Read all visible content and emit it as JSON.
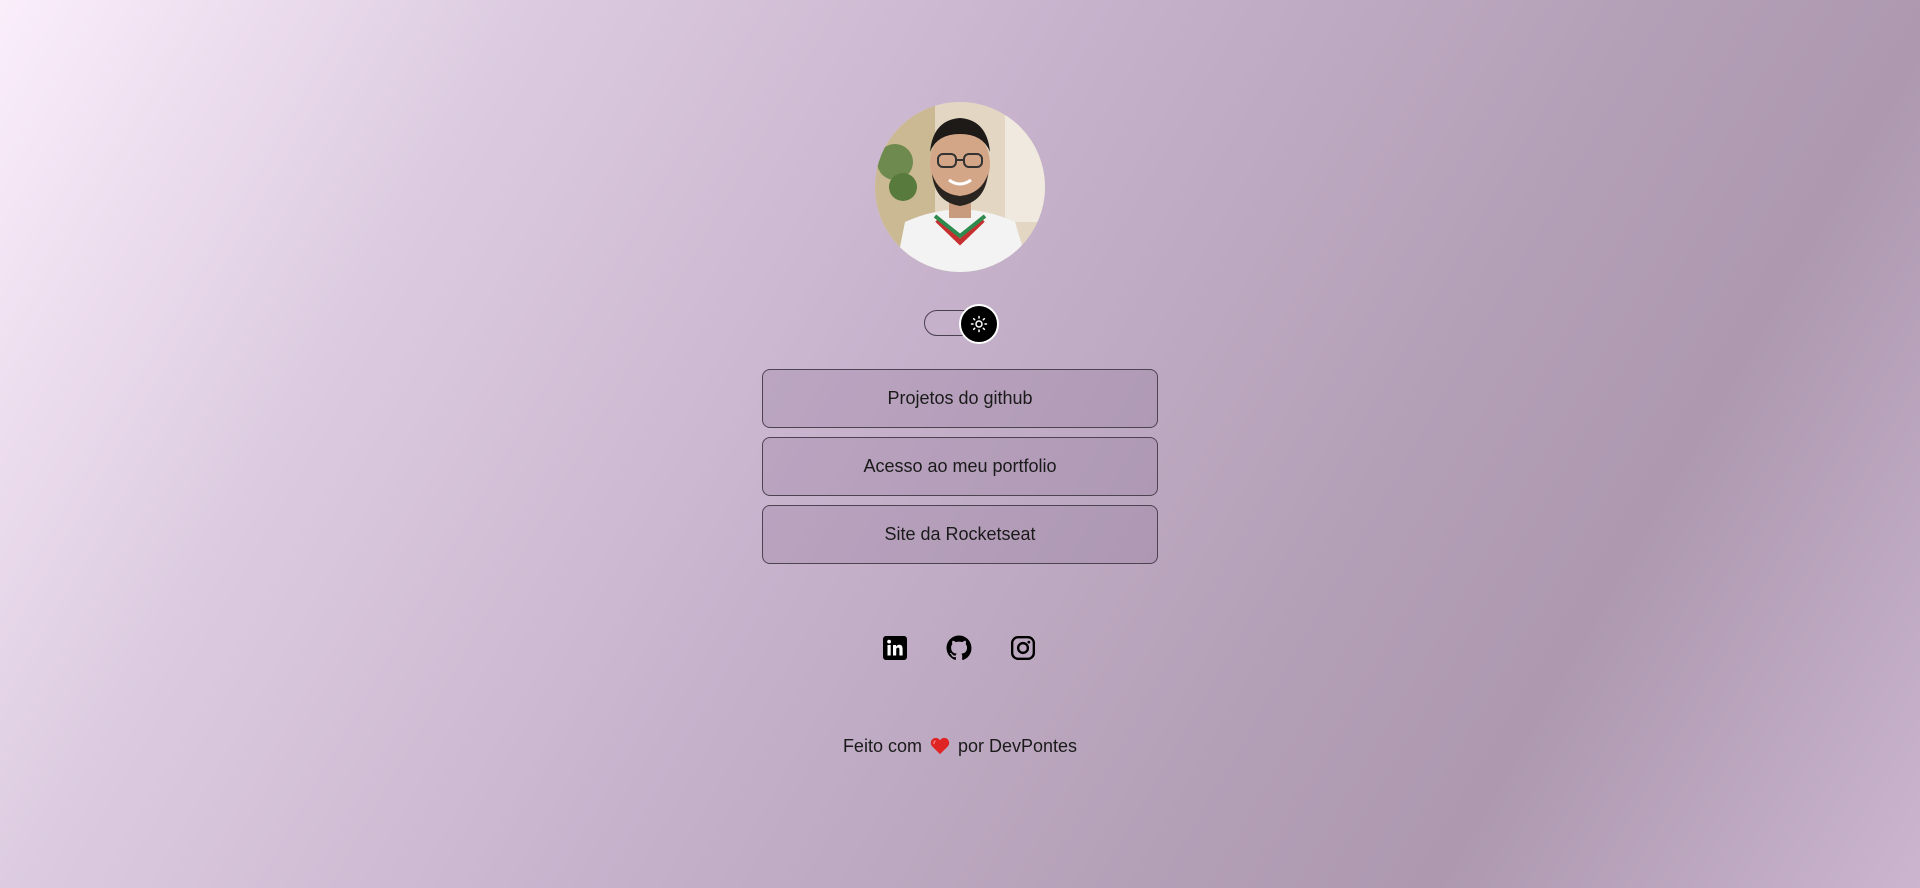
{
  "profile": {
    "avatar_icon": "profile-photo"
  },
  "theme_toggle": {
    "icon": "sun-icon",
    "state": "light"
  },
  "links": [
    {
      "label": "Projetos do github"
    },
    {
      "label": "Acesso ao meu portfolio"
    },
    {
      "label": "Site da Rocketseat"
    }
  ],
  "socials": [
    {
      "icon": "linkedin-icon"
    },
    {
      "icon": "github-icon"
    },
    {
      "icon": "instagram-icon"
    }
  ],
  "footer": {
    "prefix": "Feito com",
    "heart_icon": "heart-icon",
    "suffix": "por DevPontes"
  },
  "colors": {
    "heart": "#e02424",
    "toggle_knob": "#000000",
    "text": "#1a1a1a"
  }
}
